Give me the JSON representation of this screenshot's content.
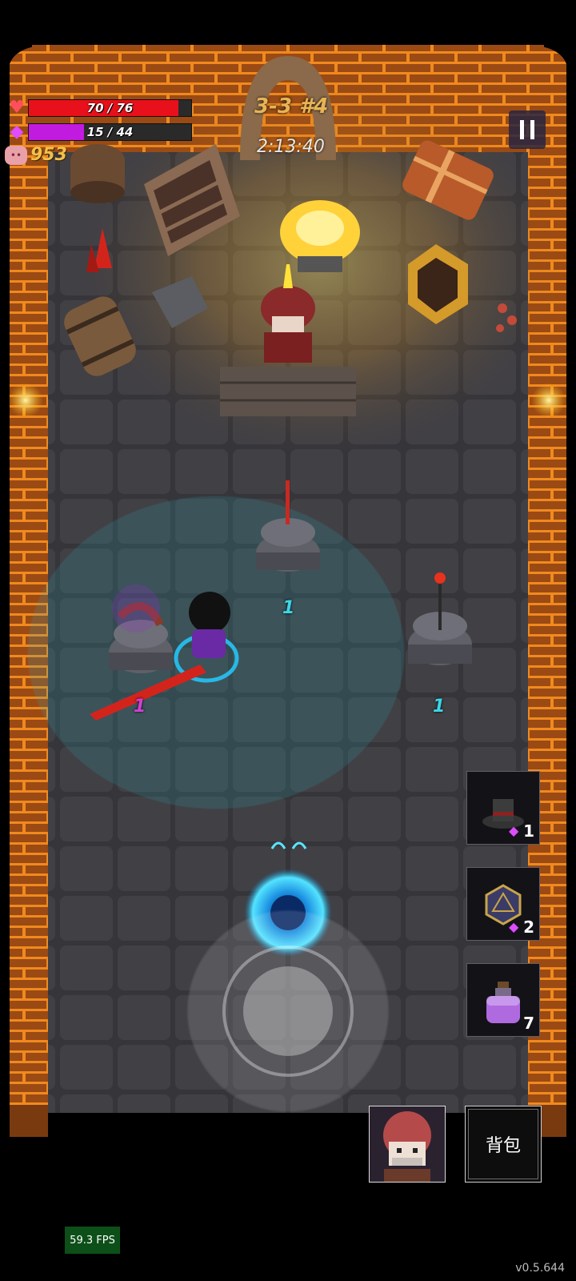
{
  "hud": {
    "hp": {
      "current": 70,
      "max": 76,
      "text": "70 / 76",
      "color": "#e8101a"
    },
    "mana": {
      "current": 15,
      "max": 44,
      "text": "15 / 44",
      "color": "#c21be0"
    },
    "gold": "953",
    "level": "3-3 #4",
    "timer": "2:13:40",
    "icons": {
      "hp": "heart-icon",
      "mana": "gem-icon",
      "gold": "pig-icon",
      "pause": "pause-icon"
    }
  },
  "damage_numbers": [
    {
      "text": "1",
      "color": "#3ad7e8"
    },
    {
      "text": "1",
      "color": "#d23fd6"
    },
    {
      "text": "1",
      "color": "#3ad7e8"
    }
  ],
  "inventory": [
    {
      "item": "top-hat",
      "cost": "1",
      "cost_icon": "gem-icon"
    },
    {
      "item": "d20-die",
      "cost": "2",
      "cost_icon": "gem-icon"
    },
    {
      "item": "potion",
      "count": "7"
    }
  ],
  "bottom": {
    "bag_label": "背包",
    "fps": "59.3 FPS",
    "version": "v0.5.644"
  }
}
